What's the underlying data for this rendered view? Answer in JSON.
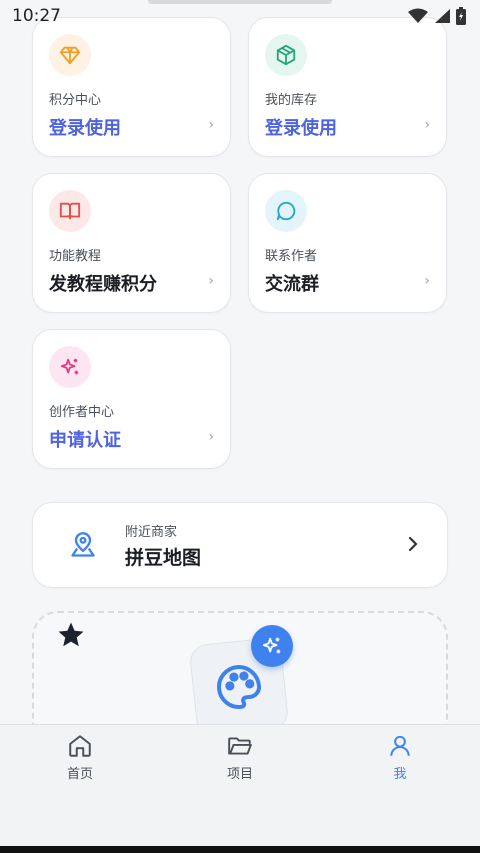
{
  "status_bar": {
    "time": "10:27"
  },
  "tiles": [
    {
      "label": "积分中心",
      "value": "登录使用",
      "icon": "diamond-icon",
      "icon_bg": "#fdf2e3",
      "icon_color": "#f0a024",
      "value_color": "#4d63e0"
    },
    {
      "label": "我的库存",
      "value": "登录使用",
      "icon": "box-icon",
      "icon_bg": "#e4f6ef",
      "icon_color": "#22a77a",
      "value_color": "#4d63e0"
    },
    {
      "label": "功能教程",
      "value": "发教程赚积分",
      "icon": "book-icon",
      "icon_bg": "#fde8e8",
      "icon_color": "#e44d4d",
      "value_color": "#1b1e24"
    },
    {
      "label": "联系作者",
      "value": "交流群",
      "icon": "chat-icon",
      "icon_bg": "#e3f5fa",
      "icon_color": "#23a6c9",
      "value_color": "#1b1e24"
    },
    {
      "label": "创作者中心",
      "value": "申请认证",
      "icon": "sparkles-icon",
      "icon_bg": "#fde6f1",
      "icon_color": "#e23c88",
      "value_color": "#4d63e0"
    }
  ],
  "nearby": {
    "label": "附近商家",
    "value": "拼豆地图",
    "icon": "map-pin-icon"
  },
  "nav": {
    "items": [
      {
        "label": "首页",
        "icon": "home-icon"
      },
      {
        "label": "项目",
        "icon": "folder-icon"
      },
      {
        "label": "我",
        "icon": "user-icon",
        "active": true
      }
    ]
  },
  "colors": {
    "accent": "#3f82ee",
    "value_blue": "#4d63e0"
  }
}
